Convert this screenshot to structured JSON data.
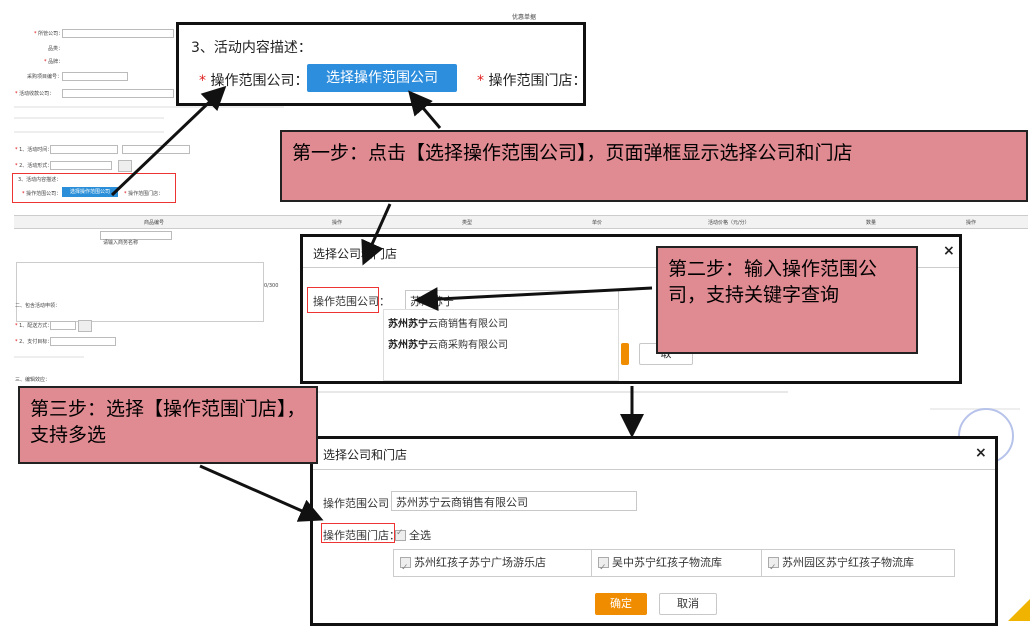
{
  "background_form": {
    "header_title": "优惠单据",
    "section_two": "二、包含活动申领：",
    "section_three": "三、编辑效应：",
    "counter": "0/300",
    "search_placeholder": "请输入商务名称",
    "select_company_button": "选择操作范围公司",
    "grid_headers": [
      "商品编号",
      "操作",
      "类型",
      "单价",
      "活动价格（元/分）",
      "数量",
      "操作"
    ]
  },
  "zoom_step3": {
    "title": "3、活动内容描述：",
    "company_label": "操作范围公司：",
    "button_label": "选择操作范围公司",
    "store_label": "操作范围门店："
  },
  "callouts": {
    "step1": "第一步：点击【选择操作范围公司】，页面弹框显示选择公司和门店",
    "step2": "第二步：输入操作范围公司，支持关键字查询",
    "step3": "第三步：选择【操作范围门店】，支持多选"
  },
  "dialog1": {
    "title": "选择公司和门店",
    "close": "×",
    "company_label": "操作范围公司：",
    "input_value": "苏州苏宁",
    "suggestions": [
      {
        "match": "苏州苏宁",
        "rest": "云商销售有限公司"
      },
      {
        "match": "苏州苏宁",
        "rest": "云商采购有限公司"
      }
    ],
    "cancel_label": "取"
  },
  "dialog2": {
    "title": "选择公司和门店",
    "close": "×",
    "company_label": "操作范围公司：",
    "company_value": "苏州苏宁云商销售有限公司",
    "store_label": "操作范围门店：",
    "select_all": "全选",
    "stores": [
      "苏州红孩子苏宁广场游乐店",
      "吴中苏宁红孩子物流库",
      "苏州园区苏宁红孩子物流库"
    ],
    "ok_label": "确定",
    "cancel_label": "取消"
  },
  "colors": {
    "callout_bg": "#e08a92",
    "primary_blue": "#2e8ede",
    "ok_orange": "#f08c00",
    "required_red": "#e02020"
  }
}
